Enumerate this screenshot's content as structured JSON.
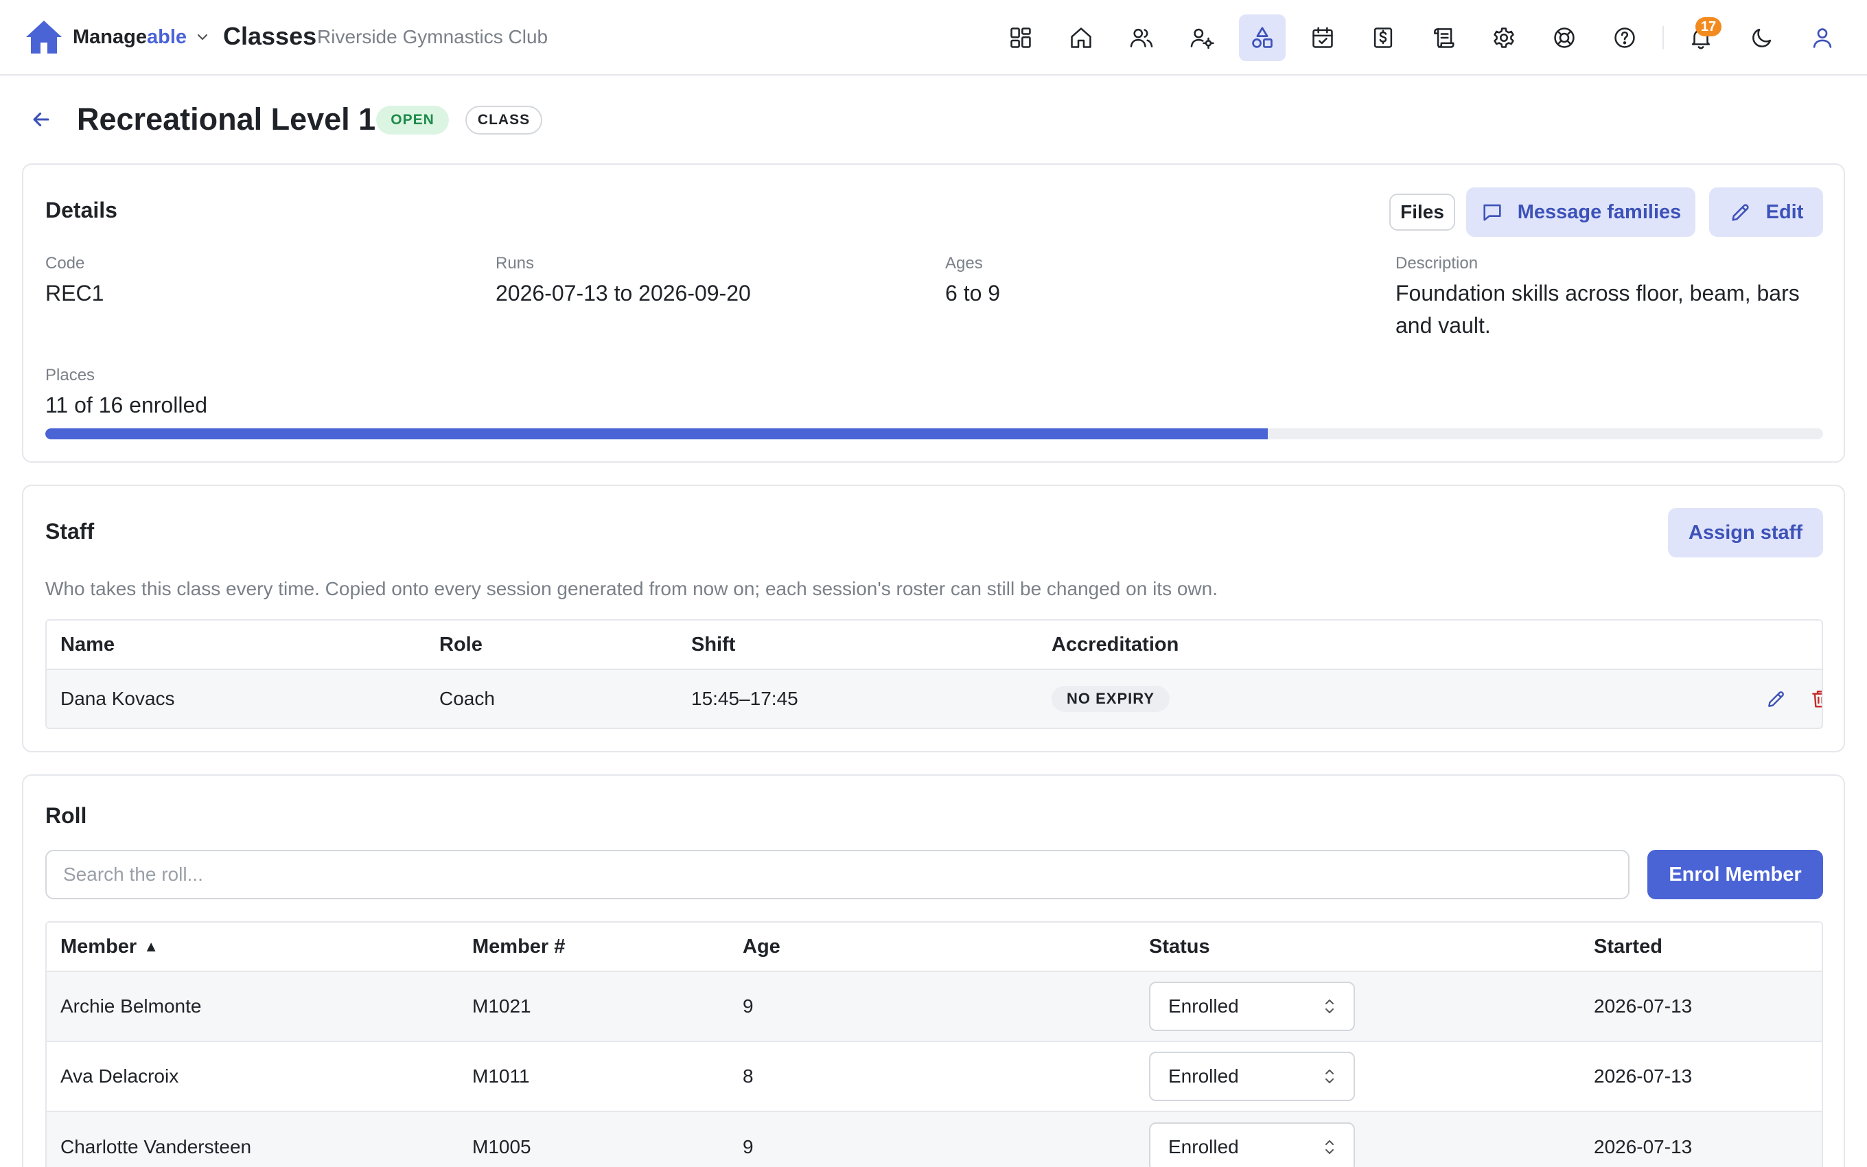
{
  "brand": {
    "name_prefix": "Manage",
    "name_accent": "able"
  },
  "header": {
    "section": "Classes",
    "organization": "Riverside Gymnastics Club"
  },
  "nav": {
    "icons": [
      "dashboard-icon",
      "home-icon",
      "users-icon",
      "user-settings-icon",
      "classes-icon",
      "calendar-check-icon",
      "billing-icon",
      "scroll-icon",
      "settings-icon",
      "support-icon",
      "help-icon",
      "bell-icon",
      "moon-icon",
      "profile-icon"
    ],
    "active": "classes-icon",
    "notification_count": "17"
  },
  "class": {
    "title": "Recreational Level 1",
    "status_badge": "OPEN",
    "type_badge": "CLASS"
  },
  "details": {
    "heading": "Details",
    "buttons": {
      "files": "Files",
      "message": "Message families",
      "edit": "Edit"
    },
    "code_label": "Code",
    "code_value": "REC1",
    "runs_label": "Runs",
    "runs_value": "2026-07-13 to 2026-09-20",
    "ages_label": "Ages",
    "ages_value": "6 to 9",
    "description_label": "Description",
    "description_value": "Foundation skills across floor, beam, bars and vault.",
    "places_label": "Places",
    "places_value": "11 of 16 enrolled",
    "enrolled": 11,
    "capacity": 16
  },
  "staff": {
    "heading": "Staff",
    "assign_button": "Assign staff",
    "helper": "Who takes this class every time. Copied onto every session generated from now on; each session's roster can still be changed on its own.",
    "columns": [
      "Name",
      "Role",
      "Shift",
      "Accreditation"
    ],
    "rows": [
      {
        "name": "Dana Kovacs",
        "role": "Coach",
        "shift": "15:45–17:45",
        "accreditation": "NO EXPIRY"
      }
    ]
  },
  "roll": {
    "heading": "Roll",
    "search_placeholder": "Search the roll...",
    "enrol_button": "Enrol Member",
    "columns": [
      "Member",
      "Member #",
      "Age",
      "Status",
      "Started"
    ],
    "sort_indicator": "▲",
    "rows": [
      {
        "member": "Archie Belmonte",
        "number": "M1021",
        "age": "9",
        "status": "Enrolled",
        "started": "2026-07-13"
      },
      {
        "member": "Ava Delacroix",
        "number": "M1011",
        "age": "8",
        "status": "Enrolled",
        "started": "2026-07-13"
      },
      {
        "member": "Charlotte Vandersteen",
        "number": "M1005",
        "age": "9",
        "status": "Enrolled",
        "started": "2026-07-13"
      }
    ]
  },
  "colors": {
    "accent": "#4a64d6",
    "accent_soft": "#dfe4fb",
    "open_green": "#1f8a4a",
    "danger": "#c62828",
    "badge_orange": "#f28b1f"
  }
}
